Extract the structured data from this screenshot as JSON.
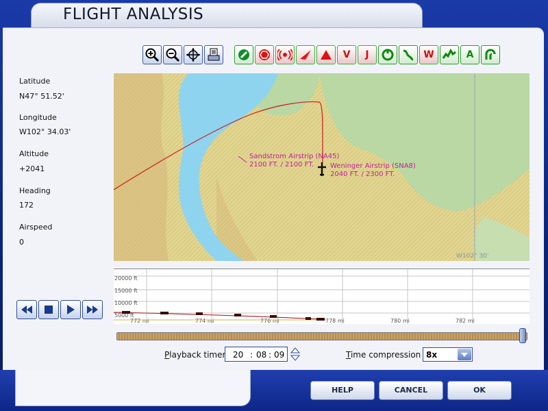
{
  "window": {
    "title": "FLIGHT ANALYSIS"
  },
  "toolbar": {
    "view_tools": [
      {
        "name": "zoom-in"
      },
      {
        "name": "zoom-out"
      },
      {
        "name": "center-aircraft"
      },
      {
        "name": "print"
      }
    ],
    "filter_tools": [
      {
        "name": "vor",
        "glyph": "✓"
      },
      {
        "name": "ndb",
        "glyph": "⬡"
      },
      {
        "name": "ils",
        "glyph": "((•))"
      },
      {
        "name": "airport",
        "glyph": "✈"
      },
      {
        "name": "intersection",
        "glyph": "▲"
      },
      {
        "name": "victor-airways",
        "glyph": "V"
      },
      {
        "name": "jet-airways",
        "glyph": "J"
      },
      {
        "name": "airspace",
        "glyph": "◎"
      },
      {
        "name": "flight-path",
        "glyph": "∿"
      },
      {
        "name": "wind",
        "glyph": "W"
      },
      {
        "name": "terrain",
        "glyph": "⌇"
      },
      {
        "name": "altitude-labels",
        "glyph": "A"
      },
      {
        "name": "profile-path",
        "glyph": "ʃ"
      }
    ]
  },
  "info": {
    "latitude_label": "Latitude",
    "latitude_value": "N47° 51.52'",
    "longitude_label": "Longitude",
    "longitude_value": "W102° 34.03'",
    "altitude_label": "Altitude",
    "altitude_value": "+2041",
    "heading_label": "Heading",
    "heading_value": "172",
    "airspeed_label": "Airspeed",
    "airspeed_value": "0"
  },
  "map": {
    "airports": [
      {
        "name": "Sandstrom Airstrip (NA45)",
        "elev": "2100  FT. / 2100  FT."
      },
      {
        "name": "Weninger Airstrip (SNA8)",
        "elev": "2040  FT. / 2300  FT."
      }
    ],
    "meridian_label": "W102° 30'",
    "path_color": "#cc1a1a",
    "label_color": "#c0209a"
  },
  "profile": {
    "y_labels": [
      "20000 ft",
      "15000 ft",
      "10000 ft",
      "5000 ft"
    ],
    "x_labels": [
      "772 mi",
      "774 mi",
      "776 mi",
      "778 mi",
      "780 mi",
      "782 mi"
    ]
  },
  "playback": {
    "progress": 0.99,
    "timer_label": "Playback timer",
    "timer_underline": "P",
    "hh": "20",
    "mm": "08",
    "ss": "09",
    "compression_label": "Time compression",
    "compression_underline": "T",
    "compression_value": "8x"
  },
  "buttons": {
    "help": "HELP",
    "cancel": "CANCEL",
    "ok": "OK"
  }
}
